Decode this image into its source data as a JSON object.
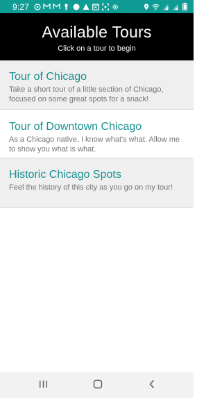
{
  "status_bar": {
    "time": "9:27",
    "background": "#0f9c94",
    "left_icons": [
      "whatsapp-icon",
      "gmail-icon",
      "gmail-icon",
      "location-pin-icon",
      "circle-app-icon",
      "image-icon",
      "calendar-icon",
      "screenshot-icon",
      "settings-icon"
    ],
    "right_icons": [
      "location-icon",
      "wifi-icon",
      "signal-icon",
      "signal-icon",
      "battery-icon"
    ]
  },
  "header": {
    "title": "Available Tours",
    "subtitle": "Click on a tour to begin",
    "background": "#000000"
  },
  "tours": [
    {
      "title": "Tour of Chicago",
      "description": "Take a short tour of a little section of Chicago, focused on some great spots for a snack!"
    },
    {
      "title": "Tour of Downtown Chicago",
      "description": "As a Chicago native, I know what's what. Allow me to show you what is what."
    },
    {
      "title": "Historic Chicago Spots",
      "description": "Feel the history of this city as you go on my tour!"
    }
  ],
  "colors": {
    "title_accent": "#1a8f91",
    "description_text": "#757575",
    "alt_row": "#efefef"
  },
  "nav_bar": {
    "buttons": [
      "recents-icon",
      "home-icon",
      "back-icon"
    ]
  }
}
